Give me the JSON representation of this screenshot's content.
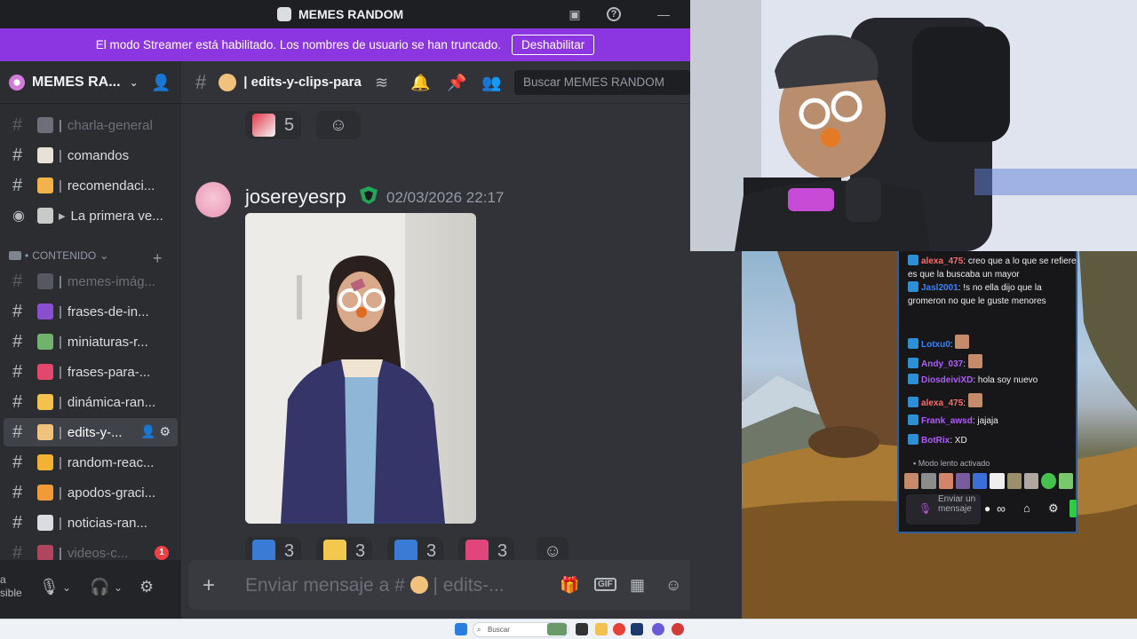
{
  "window": {
    "title": "MEMES RANDOM"
  },
  "streamer_banner": {
    "message": "El modo Streamer está habilitado. Los nombres de usuario se han truncado.",
    "button": "Deshabilitar"
  },
  "server": {
    "name": "MEMES RA..."
  },
  "channels": [
    {
      "label": "charla-general",
      "sep": "|",
      "emoji_color": "#6d6f78",
      "dim": true
    },
    {
      "label": "comandos",
      "sep": "|",
      "emoji_color": "#e8e1d5",
      "dim": false
    },
    {
      "label": "recomendaci...",
      "sep": "|",
      "emoji_color": "#f3b24a",
      "dim": false
    },
    {
      "label": "La primera ve...",
      "sep": "▸",
      "emoji_color": "#c9c9c9",
      "dim": false
    }
  ],
  "category": {
    "label": "CONTENIDO"
  },
  "content_channels": [
    {
      "label": "memes-imág...",
      "sep": "|",
      "emoji_color": "#555860",
      "dim": true
    },
    {
      "label": "frases-de-in...",
      "sep": "|",
      "emoji_color": "#8a4fd1",
      "dim": false
    },
    {
      "label": "miniaturas-r...",
      "sep": "|",
      "emoji_color": "#6fb36d",
      "dim": false
    },
    {
      "label": "frases-para-...",
      "sep": "|",
      "emoji_color": "#e2486c",
      "dim": false
    },
    {
      "label": "dinámica-ran...",
      "sep": "|",
      "emoji_color": "#f2c14e",
      "dim": false
    },
    {
      "label": "edits-y-...",
      "sep": "|",
      "emoji_color": "#f0c27b",
      "dim": false,
      "active": true
    },
    {
      "label": "random-reac...",
      "sep": "|",
      "emoji_color": "#f2b233",
      "dim": false
    },
    {
      "label": "apodos-graci...",
      "sep": "|",
      "emoji_color": "#f09a3a",
      "dim": false
    },
    {
      "label": "noticias-ran...",
      "sep": "|",
      "emoji_color": "#d9dce1",
      "dim": false
    },
    {
      "label": "videos-c...",
      "sep": "|",
      "emoji_color": "#b0455e",
      "dim": true,
      "badge": "1"
    }
  ],
  "user_panel": {
    "status_line1": "a",
    "status_line2": "sible"
  },
  "channel_header": {
    "name": "| edits-y-clips-para"
  },
  "search": {
    "placeholder": "Buscar MEMES RANDOM"
  },
  "top_reaction": {
    "count": "5"
  },
  "message": {
    "author": "josereyesrp",
    "timestamp": "02/03/2026 22:17"
  },
  "reactions": [
    {
      "count": "3",
      "color": "#3a7bd5"
    },
    {
      "count": "3",
      "color": "#f2c94c"
    },
    {
      "count": "3",
      "color": "#3a7bd5"
    },
    {
      "count": "3",
      "color": "#e0457b"
    }
  ],
  "composer": {
    "placeholder": "Enviar mensaje a #",
    "channel": "| edits-..."
  },
  "twitch_chat": {
    "messages": [
      {
        "user": "alexa_475",
        "user_color": "#ff6b6b",
        "text": "creo que a lo que se refiere es que la buscaba un mayor"
      },
      {
        "user": "Jasl2001",
        "user_color": "#3b82f6",
        "text": "!s no ella dijo que la gromeron no que le guste menores"
      },
      {
        "user": "Lotxu0",
        "user_color": "#3b82f6",
        "text": ""
      },
      {
        "user": "Andy_037",
        "user_color": "#b05cff",
        "text": ""
      },
      {
        "user": "DiosdeiviXD",
        "user_color": "#b05cff",
        "text": "hola soy nuevo"
      },
      {
        "user": "alexa_475",
        "user_color": "#ff6b6b",
        "text": ""
      },
      {
        "user": "Frank_awsd",
        "user_color": "#b05cff",
        "text": "jajaja"
      },
      {
        "user": "BotRix",
        "user_color": "#b05cff",
        "text": "XD"
      }
    ],
    "slow_mode": "Modo lento activado",
    "input_placeholder": "Enviar un mensaje"
  },
  "taskbar": {
    "search": "Buscar"
  }
}
